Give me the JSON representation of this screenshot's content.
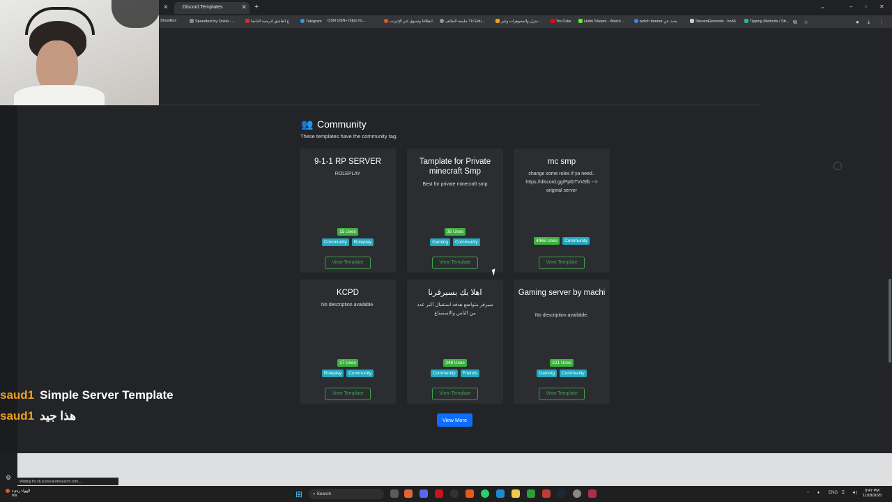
{
  "browser": {
    "active_tab": "Discord Templates",
    "bookmarks": [
      "ShowBox",
      "Speedtest by Ookla - ...",
      "ع العاشق لترجمة الدانجا",
      "Telegram",
      "OSN OSN+ https://o...",
      "انطلاقا وتسوق عبر الإنترنت",
      "جامعة الطائف TU Edu...",
      "منزل والمجوهرات وغير...",
      "YouTube",
      "Hob6 Stream - Watch ...",
      "twitch banner يحث عن",
      "StreamElements - hob6",
      "Tipping Methods / Str..."
    ],
    "status_text": "Waiting for sb.scorecardresearch.com..."
  },
  "section": {
    "title": "Community",
    "subtitle": "These templates have the community tag."
  },
  "cards": [
    {
      "title": "9-1-1 RP SERVER",
      "desc": "ROLEPLAY",
      "uses": "15 Uses",
      "tags": [
        "Community",
        "Roleplay"
      ],
      "button": "View Template"
    },
    {
      "title": "Tamplate for Private minecraft Smp",
      "desc": "Best for private minecraft smp",
      "uses": "35 Uses",
      "tags": [
        "Gaming",
        "Community"
      ],
      "button": "View Template"
    },
    {
      "title": "mc smp",
      "desc": "change some roles if ya need.. https://discord.gg/PptbTVxSfb --> original server",
      "uses": "4966 Uses",
      "tags": [
        "Community"
      ],
      "button": "View Template"
    },
    {
      "title": "KCPD",
      "desc": "No description available.",
      "uses": "17 Uses",
      "tags": [
        "Roleplay",
        "Community"
      ],
      "button": "View Template"
    },
    {
      "title": "اهلا بك بسيرفرنا",
      "desc": "سيرفر متواضع هدفه استقبال اكبر عدد من الناس والاستمتاع",
      "uses": "348 Uses",
      "tags": [
        "Community",
        "Friends"
      ],
      "button": "View Template"
    },
    {
      "title": "Gaming server by machi",
      "desc": "No description available.",
      "uses": "221 Uses",
      "tags": [
        "Gaming",
        "Community"
      ],
      "button": "View Template"
    }
  ],
  "view_more": "View More",
  "chat": [
    {
      "user": "saud1",
      "message": "Simple Server Template"
    },
    {
      "user": "saud1",
      "message": "هذا جيد"
    }
  ],
  "taskbar": {
    "weather": "الهواء رديء",
    "weather_sub": "Ins",
    "search": "Search",
    "lang": "ENG",
    "time": "9:47 PM",
    "date": "11/18/2025"
  }
}
